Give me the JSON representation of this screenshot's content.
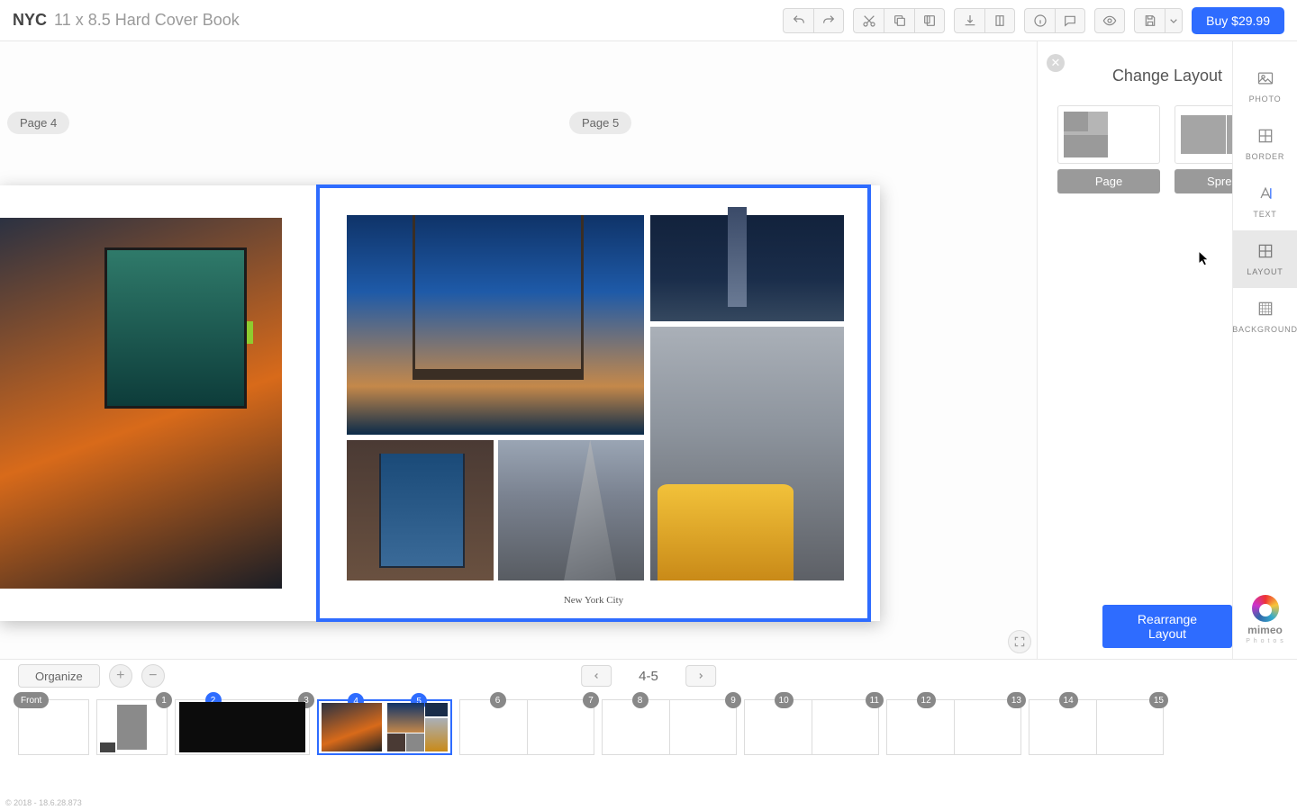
{
  "header": {
    "project_name": "NYC",
    "product_spec": "11 x 8.5 Hard Cover Book",
    "buy_label": "Buy $29.99"
  },
  "canvas": {
    "page_left_label": "Page 4",
    "page_right_label": "Page 5",
    "caption_text": "New York City"
  },
  "panel": {
    "title": "Change Layout",
    "option_page_label": "Page",
    "option_spread_label": "Spread",
    "rearrange_label": "Rearrange Layout"
  },
  "rail": {
    "photo": "PHOTO",
    "border": "BORDER",
    "text": "TEXT",
    "layout": "LAYOUT",
    "background": "BACKGROUND",
    "brand_name": "mimeo",
    "brand_sub": "P h o t o s"
  },
  "filmstrip": {
    "organize_label": "Organize",
    "current_range": "4-5",
    "thumbs": [
      {
        "badge": "Front"
      },
      {
        "badge": "1"
      },
      {
        "badge": "2",
        "b2": "3"
      },
      {
        "badge": "4",
        "b2": "5"
      },
      {
        "badge": "6",
        "b2": "7"
      },
      {
        "badge": "8",
        "b2": "9"
      },
      {
        "badge": "10",
        "b2": "11"
      },
      {
        "badge": "12",
        "b2": "13"
      },
      {
        "badge": "14",
        "b2": "15"
      }
    ]
  },
  "footer": {
    "note": "© 2018 - 18.6.28.873"
  }
}
